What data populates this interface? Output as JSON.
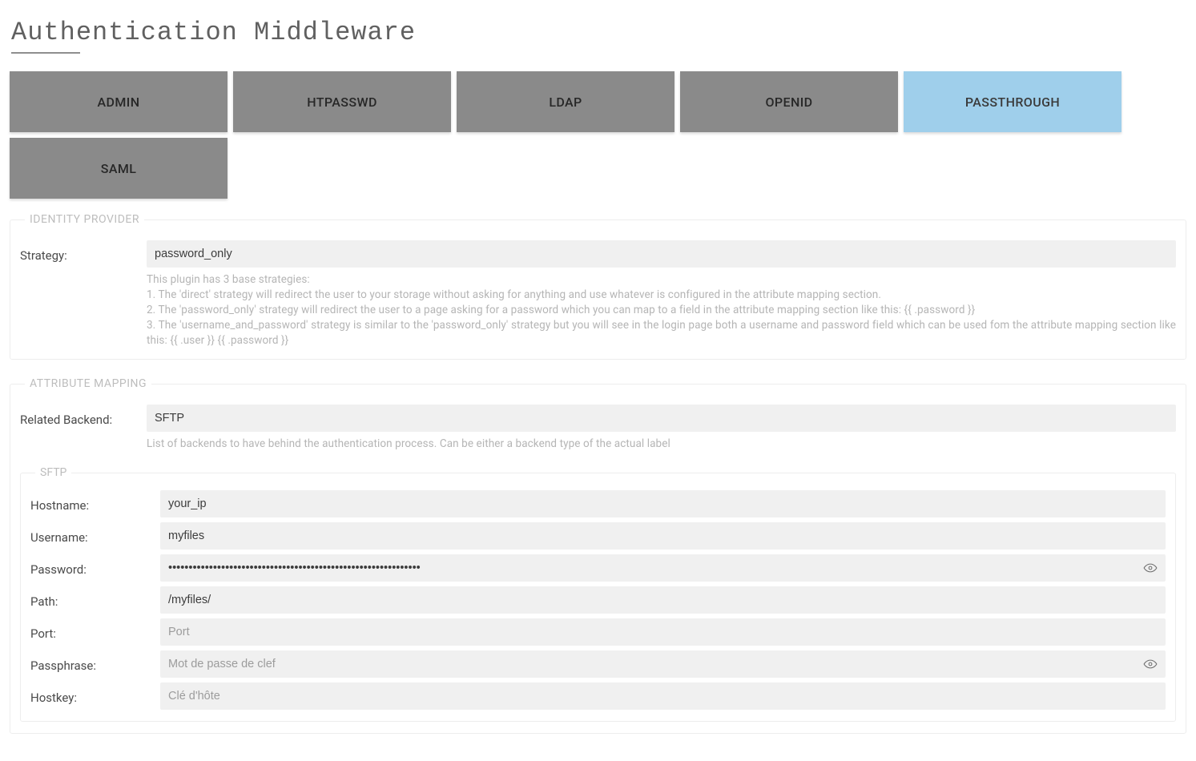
{
  "title": "Authentication Middleware",
  "tabs": [
    {
      "label": "ADMIN",
      "active": false
    },
    {
      "label": "HTPASSWD",
      "active": false
    },
    {
      "label": "LDAP",
      "active": false
    },
    {
      "label": "OPENID",
      "active": false
    },
    {
      "label": "PASSTHROUGH",
      "active": true
    },
    {
      "label": "SAML",
      "active": false
    }
  ],
  "identity_provider": {
    "legend": "IDENTITY PROVIDER",
    "strategy_label": "Strategy:",
    "strategy_value": "password_only",
    "help": "This plugin has 3 base strategies:\n1. The 'direct' strategy will redirect the user to your storage without asking for anything and use whatever is configured in the attribute mapping section.\n2. The 'password_only' strategy will redirect the user to a page asking for a password which you can map to a field in the attribute mapping section like this: {{ .password }}\n3. The 'username_and_password' strategy is similar to the 'password_only' strategy but you will see in the login page both a username and password field which can be used fom the attribute mapping section like this: {{ .user }} {{ .password }}"
  },
  "attribute_mapping": {
    "legend": "ATTRIBUTE MAPPING",
    "related_backend_label": "Related Backend:",
    "related_backend_value": "SFTP",
    "help": "List of backends to have behind the authentication process. Can be either a backend type of the actual label"
  },
  "sftp": {
    "legend": "SFTP",
    "fields": {
      "hostname": {
        "label": "Hostname:",
        "value": "your_ip",
        "placeholder": ""
      },
      "username": {
        "label": "Username:",
        "value": "myfiles",
        "placeholder": ""
      },
      "password": {
        "label": "Password:",
        "value": "••••••••••••••••••••••••••••••••••••••••••••••••••••••••••••••",
        "placeholder": ""
      },
      "path": {
        "label": "Path:",
        "value": "/myfiles/",
        "placeholder": ""
      },
      "port": {
        "label": "Port:",
        "value": "",
        "placeholder": "Port"
      },
      "passphrase": {
        "label": "Passphrase:",
        "value": "",
        "placeholder": "Mot de passe de clef"
      },
      "hostkey": {
        "label": "Hostkey:",
        "value": "",
        "placeholder": "Clé d'hôte"
      }
    }
  }
}
